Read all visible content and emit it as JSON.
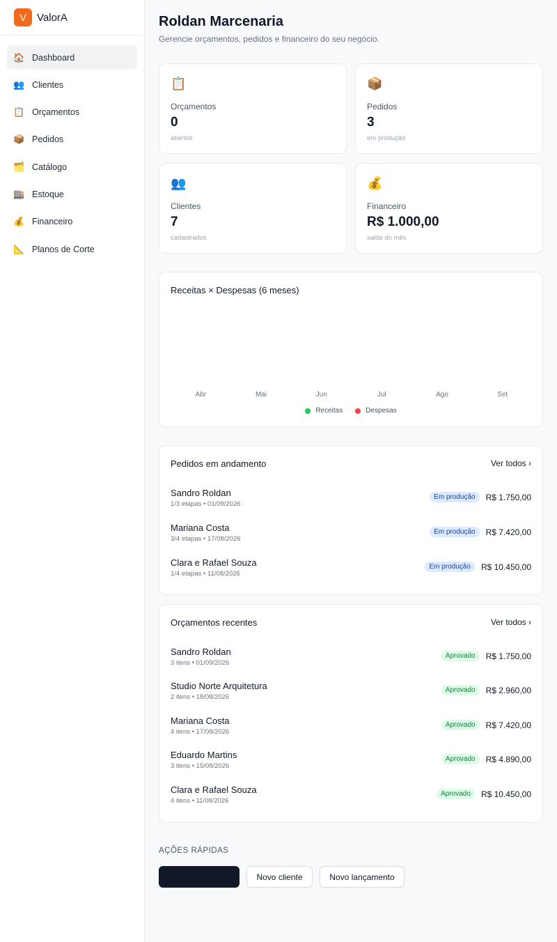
{
  "brand": {
    "logo_letter": "V",
    "name": "ValorA"
  },
  "sidebar": {
    "items": [
      {
        "icon": "🏠",
        "label": "Dashboard"
      },
      {
        "icon": "👥",
        "label": "Clientes"
      },
      {
        "icon": "📋",
        "label": "Orçamentos"
      },
      {
        "icon": "📦",
        "label": "Pedidos"
      },
      {
        "icon": "🗂️",
        "label": "Catálogo"
      },
      {
        "icon": "🏬",
        "label": "Estoque"
      },
      {
        "icon": "💰",
        "label": "Financeiro"
      },
      {
        "icon": "📐",
        "label": "Planos de Corte"
      }
    ]
  },
  "header": {
    "title": "Roldan Marcenaria",
    "subtitle": "Gerencie orçamentos, pedidos e financeiro do seu negócio."
  },
  "stats": [
    {
      "icon": "📋",
      "label": "Orçamentos",
      "value": "0",
      "note": "abertos"
    },
    {
      "icon": "📦",
      "label": "Pedidos",
      "value": "3",
      "note": "em produção"
    },
    {
      "icon": "👥",
      "label": "Clientes",
      "value": "7",
      "note": "cadastrados"
    },
    {
      "icon": "💰",
      "label": "Financeiro",
      "value": "R$ 1.000,00",
      "note": "saldo do mês"
    }
  ],
  "chart": {
    "title": "Receitas × Despesas (6 meses)"
  },
  "chart_data": {
    "type": "bar",
    "title": "Receitas × Despesas (6 meses)",
    "categories": [
      "Abr",
      "Mai",
      "Jun",
      "Jul",
      "Ago",
      "Set"
    ],
    "series": [
      {
        "name": "Receitas",
        "color": "#22c55e",
        "values": [
          0,
          0,
          0,
          0,
          0,
          0
        ]
      },
      {
        "name": "Despesas",
        "color": "#ef4444",
        "values": [
          0,
          0,
          0,
          0,
          0,
          0
        ]
      }
    ],
    "legend": "bottom-center",
    "grid": false
  },
  "orders": {
    "title": "Pedidos em andamento",
    "see_all": "Ver todos ›",
    "rows": [
      {
        "name": "Sandro Roldan",
        "steps": "1/3 etapas",
        "date": "01/09/2026",
        "status": "Em produção",
        "amount": "R$ 1.750,00"
      },
      {
        "name": "Mariana Costa",
        "steps": "3/4 etapas",
        "date": "17/08/2026",
        "status": "Em produção",
        "amount": "R$ 7.420,00"
      },
      {
        "name": "Clara e Rafael Souza",
        "steps": "1/4 etapas",
        "date": "11/08/2026",
        "status": "Em produção",
        "amount": "R$ 10.450,00"
      }
    ]
  },
  "quotes": {
    "title": "Orçamentos recentes",
    "see_all": "Ver todos ›",
    "rows": [
      {
        "name": "Sandro Roldan",
        "items": "3 itens",
        "date": "01/09/2026",
        "status": "Aprovado",
        "amount": "R$ 1.750,00"
      },
      {
        "name": "Studio Norte Arquitetura",
        "items": "2 itens",
        "date": "18/08/2026",
        "status": "Aprovado",
        "amount": "R$ 2.960,00"
      },
      {
        "name": "Mariana Costa",
        "items": "4 itens",
        "date": "17/08/2026",
        "status": "Aprovado",
        "amount": "R$ 7.420,00"
      },
      {
        "name": "Eduardo Martins",
        "items": "3 itens",
        "date": "15/08/2026",
        "status": "Aprovado",
        "amount": "R$ 4.890,00"
      },
      {
        "name": "Clara e Rafael Souza",
        "items": "4 itens",
        "date": "11/08/2026",
        "status": "Aprovado",
        "amount": "R$ 10.450,00"
      }
    ]
  },
  "quick_actions": {
    "title": "AÇÕES RÁPIDAS",
    "buttons": [
      {
        "label": ""
      },
      {
        "label": "Novo cliente"
      },
      {
        "label": "Novo lançamento"
      }
    ]
  },
  "meta_separator": "•"
}
